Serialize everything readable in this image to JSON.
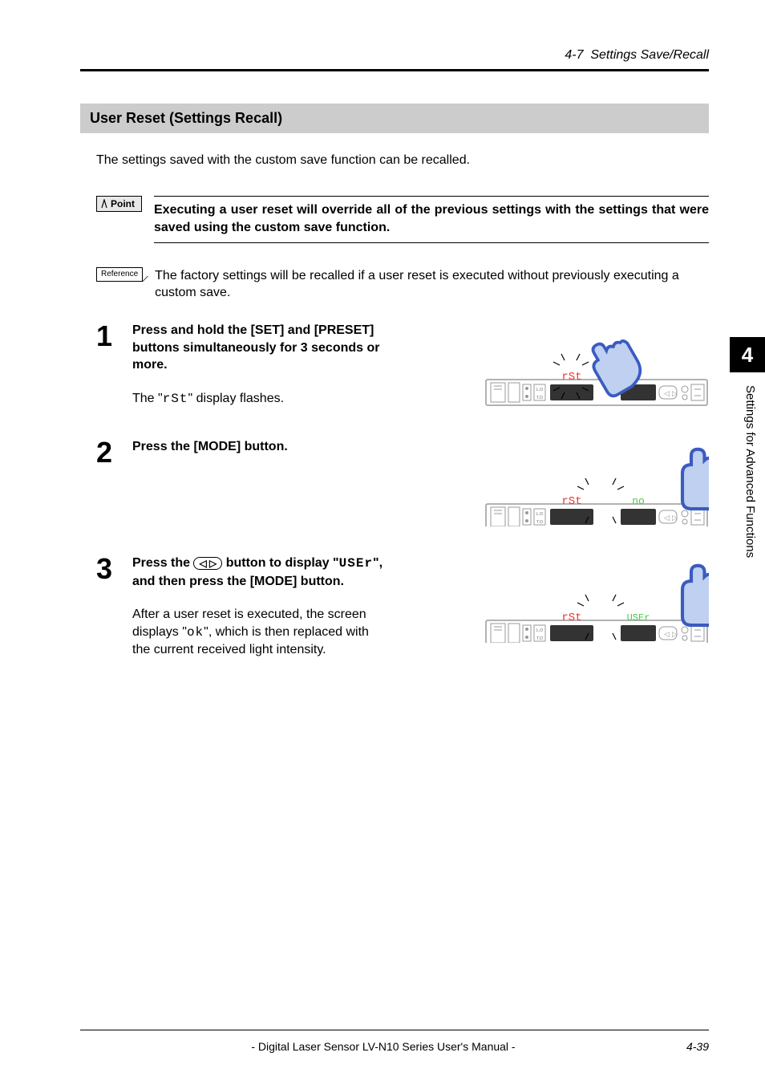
{
  "header": {
    "section_number": "4-7",
    "section_title": "Settings Save/Recall"
  },
  "subsection": {
    "title": "User Reset (Settings Recall)"
  },
  "intro": "The settings saved with the custom save function can be recalled.",
  "point": {
    "label": "Point",
    "text": "Executing a user reset will override all of the previous settings with the settings that were saved using the custom save function."
  },
  "reference": {
    "label": "Reference",
    "text": "The factory settings will be recalled if a user reset is executed without previously executing a custom save."
  },
  "steps": [
    {
      "num": "1",
      "title": "Press and hold the [SET] and [PRESET] buttons simultaneously for 3 seconds or more.",
      "desc_prefix": "The \"",
      "seg": "rSt",
      "desc_suffix": "\" display flashes."
    },
    {
      "num": "2",
      "title": "Press the [MODE] button.",
      "desc_prefix": "",
      "seg": "",
      "desc_suffix": ""
    },
    {
      "num": "3",
      "title_prefix": "Press the ",
      "btn": "◁  ▷",
      "title_mid": " button to display \"",
      "title_seg": "USEr",
      "title_suffix": "\", and then press the [MODE] button.",
      "desc_prefix": "After a user reset is executed, the screen displays \"",
      "seg": "ok",
      "desc_suffix": "\", which is then replaced with the current received light intensity."
    }
  ],
  "displays": {
    "d1_left": "rSt",
    "d2_left": "rSt",
    "d2_right": "no",
    "d3_left": "rSt",
    "d3_right": "USEr"
  },
  "side": {
    "chapter": "4",
    "title": "Settings for Advanced Functions"
  },
  "footer": {
    "center": "- Digital Laser Sensor LV-N10 Series User's Manual -",
    "page": "4-39"
  }
}
